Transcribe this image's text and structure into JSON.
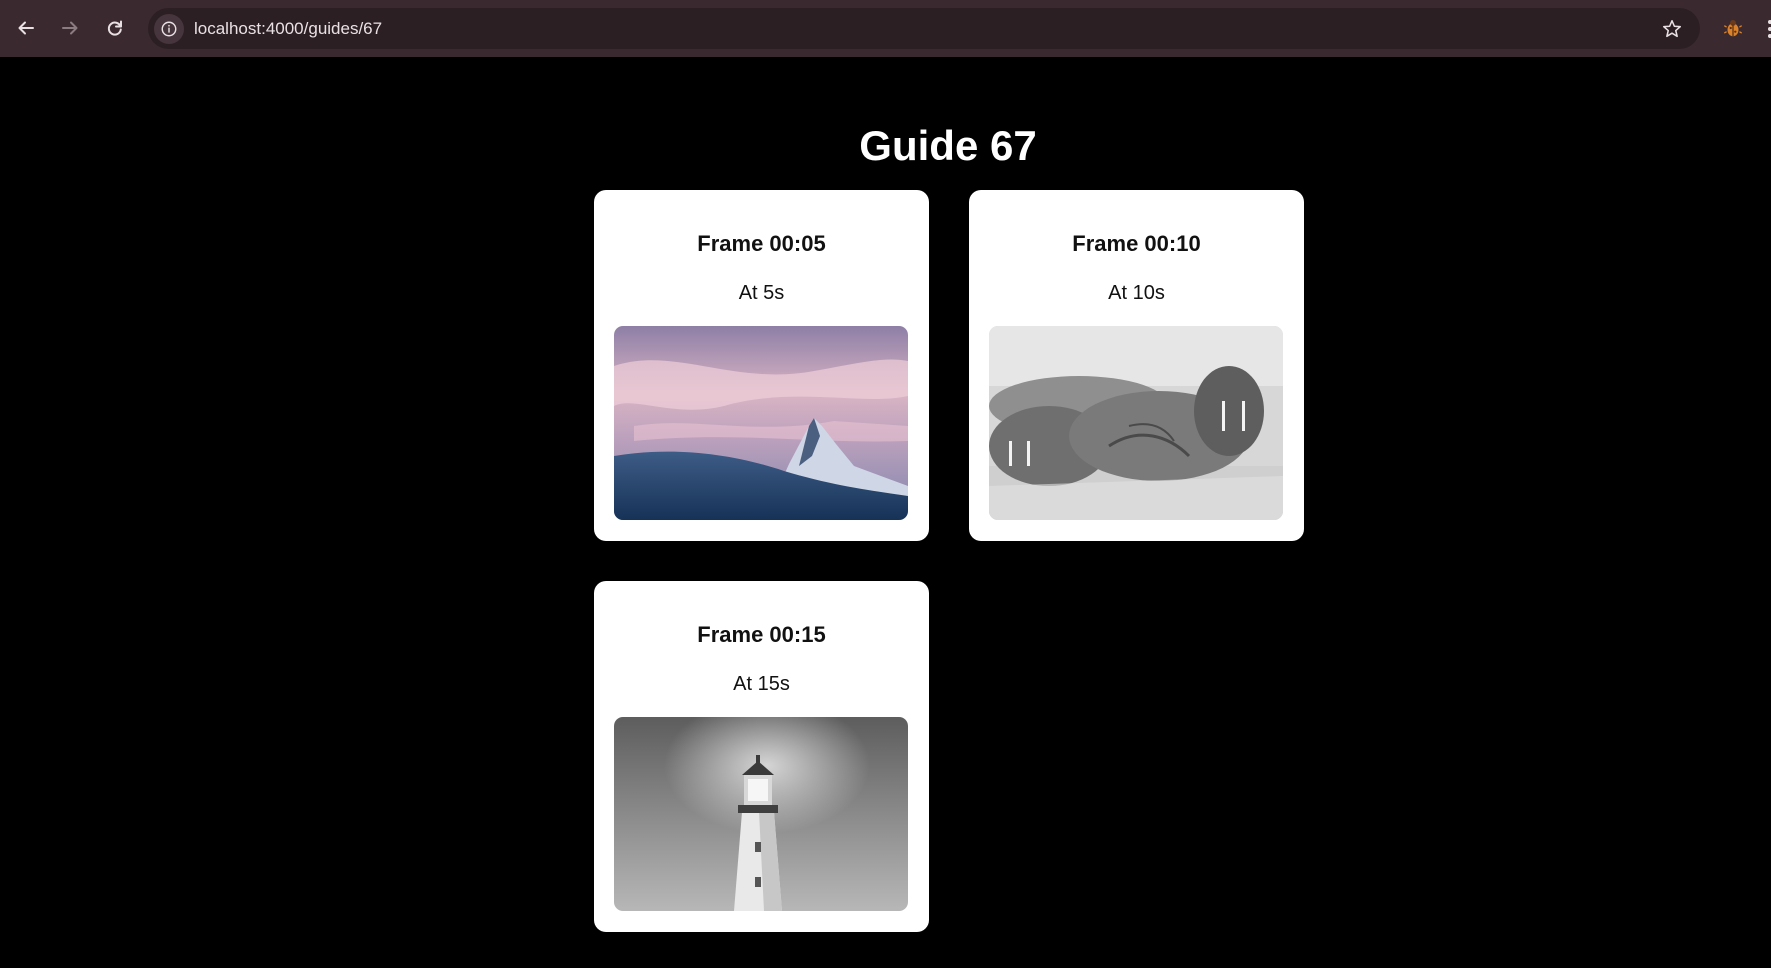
{
  "browser": {
    "url": "localhost:4000/guides/67",
    "icons": {
      "back": "arrow-left-icon",
      "forward": "arrow-right-icon",
      "reload": "reload-icon",
      "site_info": "info-icon",
      "bookmark": "star-icon",
      "extension": "bug-extension-icon"
    }
  },
  "page": {
    "title": "Guide 67"
  },
  "frames": [
    {
      "title": "Frame 00:05",
      "subtitle": "At 5s",
      "image": "mountain-peak-at-sunset"
    },
    {
      "title": "Frame 00:10",
      "subtitle": "At 10s",
      "image": "walruses-on-beach-black-and-white"
    },
    {
      "title": "Frame 00:15",
      "subtitle": "At 15s",
      "image": "lighthouse-black-and-white"
    }
  ],
  "colors": {
    "page_background": "#000000",
    "card_background": "#ffffff",
    "chrome_background": "#3a2a30",
    "omnibox_background": "#2b1f24"
  }
}
